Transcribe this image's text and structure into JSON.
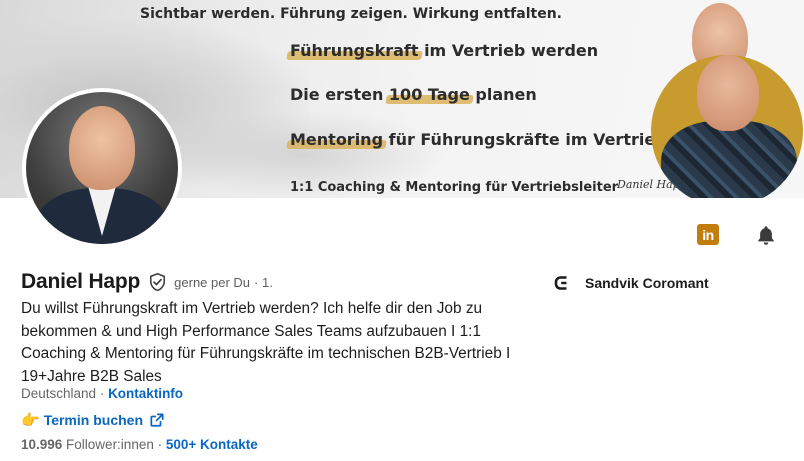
{
  "banner": {
    "tagline": "Sichtbar werden. Führung zeigen. Wirkung entfalten.",
    "line1_highlight": "Führungskraft",
    "line1_rest": " im Vertrieb werden",
    "line2_pre": "Die ersten ",
    "line2_highlight": "100 Tage",
    "line2_rest": " planen",
    "line3_highlight": "Mentoring",
    "line3_rest": " für Führungskräfte im Vertrieb",
    "line4": "1:1 Coaching & Mentoring für Vertriebsleiter",
    "signature": "Daniel Happ"
  },
  "actions": {
    "linkedin_label": "in"
  },
  "profile": {
    "name": "Daniel Happ",
    "pronoun": "gerne per Du",
    "degree": "· 1.",
    "headline": "Du willst Führungskraft im Vertrieb werden? Ich helfe dir den Job zu bekommen & und High Performance Sales Teams aufzubauen I 1:1 Coaching & Mentoring für Führungskräfte im technischen B2B-Vertrieb I 19+Jahre B2B Sales",
    "location": "Deutschland",
    "separator": " · ",
    "contact_info": "Kontaktinfo",
    "booking_emoji": "👉",
    "booking_link": "Termin buchen",
    "followers_count": "10.996",
    "followers_label": " Follower:innen",
    "follow_sep": " · ",
    "connections": "500+ Kontakte"
  },
  "company": {
    "name": "Sandvik Coromant"
  },
  "colors": {
    "link": "#0a66c2",
    "linkedin_icon_bg": "#c37d0f",
    "banner_highlight": "#d9b15a"
  },
  "icons": [
    "linkedin-icon",
    "bell-icon",
    "verified-shield-icon",
    "external-link-icon",
    "sandvik-logo-icon",
    "pointing-hand-icon"
  ]
}
